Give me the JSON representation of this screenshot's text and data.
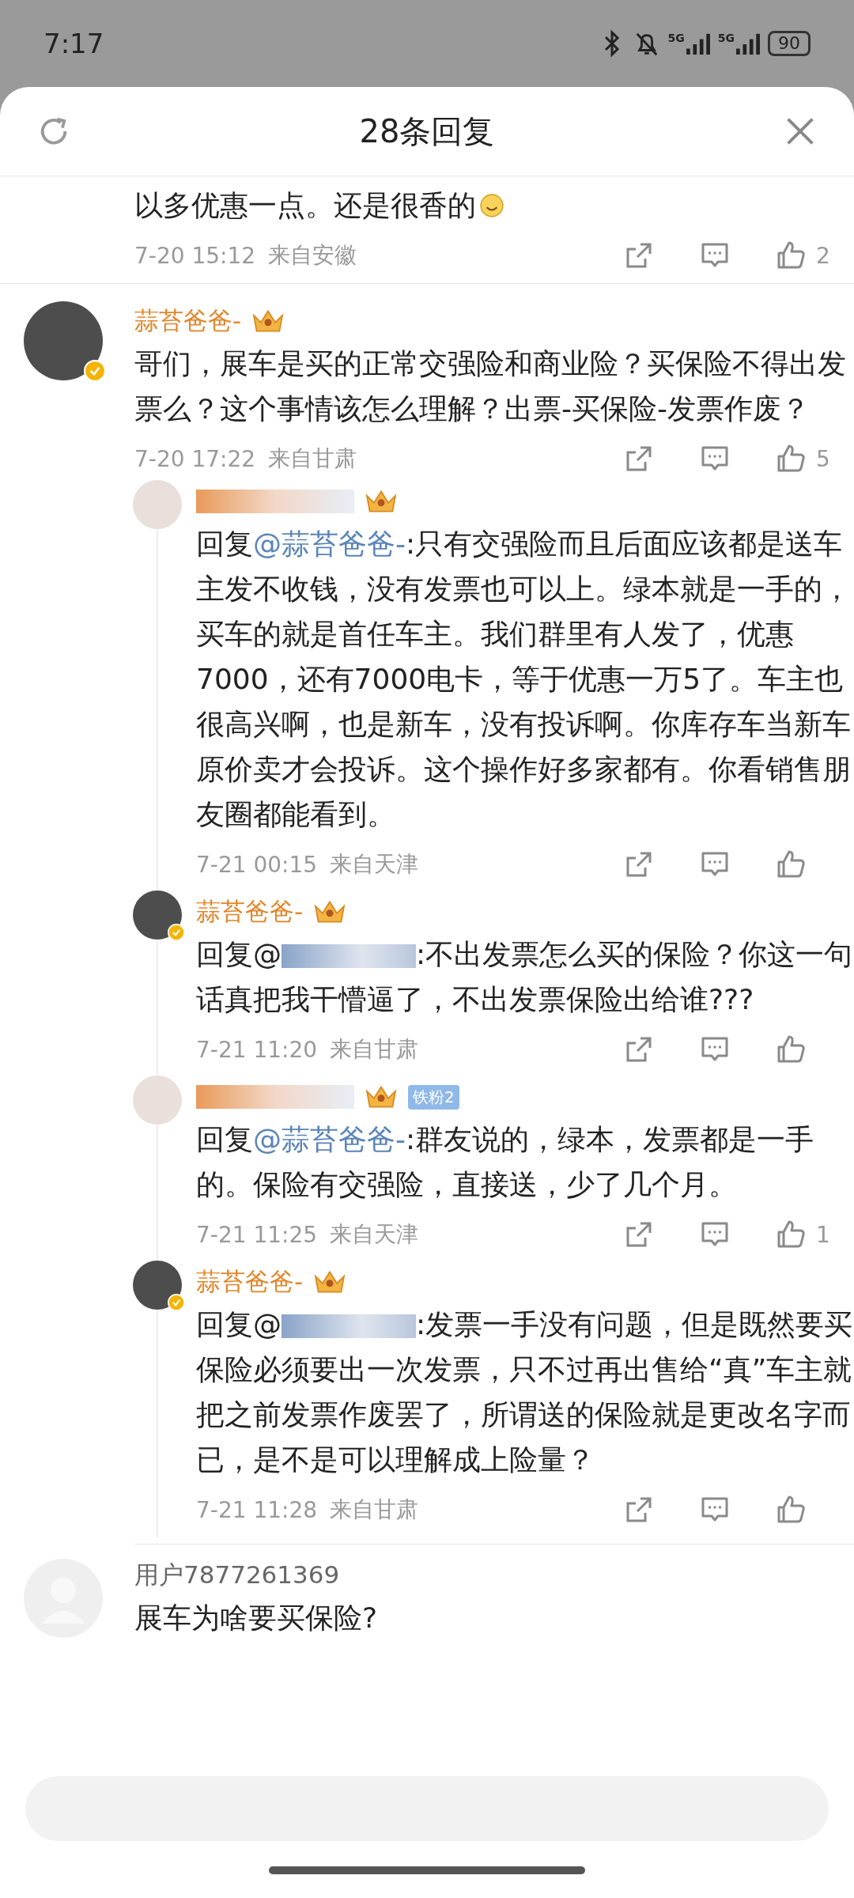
{
  "status_bar": {
    "time": "7:17",
    "networks": [
      "5G",
      "5G"
    ],
    "battery": "90"
  },
  "header": {
    "title": "28条回复"
  },
  "tail": {
    "text": "以多优惠一点。还是很香的",
    "emoji": true,
    "time": "7-20 15:12",
    "location": "来自安徽",
    "likes": "2"
  },
  "comment": {
    "author": "蒜苔爸爸-",
    "verified": true,
    "crown": true,
    "text": "哥们，展车是买的正常交强险和商业险？买保险不得出发票么？这个事情该怎么理解？出票-买保险-发票作废？",
    "time": "7-20 17:22",
    "location": "来自甘肃",
    "likes": "5",
    "replies": [
      {
        "verified": false,
        "crown": true,
        "prefix": "回复",
        "mention": "@蒜苔爸爸-",
        "text": ":只有交强险而且后面应该都是送车主发不收钱，没有发票也可以上。绿本就是一手的，买车的就是首任车主。我们群里有人发了，优惠7000，还有7000电卡，等于优惠一万5了。车主也很高兴啊，也是新车，没有投诉啊。你库存车当新车原价卖才会投诉。这个操作好多家都有。你看销售朋友圈都能看到。",
        "time": "7-21 00:15",
        "location": "来自天津"
      },
      {
        "author": "蒜苔爸爸-",
        "verified": true,
        "crown": true,
        "prefix": "回复@",
        "text": ":不出发票怎么买的保险？你这一句话真把我干懵逼了，不出发票保险出给谁???",
        "time": "7-21 11:20",
        "location": "来自甘肃"
      },
      {
        "verified": false,
        "crown": true,
        "badge": "铁粉2",
        "prefix": "回复",
        "mention": "@蒜苔爸爸-",
        "text": ":群友说的，绿本，发票都是一手的。保险有交强险，直接送，少了几个月。",
        "time": "7-21 11:25",
        "location": "来自天津",
        "likes": "1"
      },
      {
        "author": "蒜苔爸爸-",
        "verified": true,
        "crown": true,
        "prefix": "回复@",
        "text": ":发票一手没有问题，但是既然要买保险必须要出一次发票，只不过再出售给“真”车主就把之前发票作废罢了，所谓送的保险就是更改名字而已，是不是可以理解成上险量？",
        "time": "7-21 11:28",
        "location": "来自甘肃"
      }
    ]
  },
  "next_comment": {
    "author": "用户7877261369",
    "text": "展车为啥要买保险?"
  }
}
